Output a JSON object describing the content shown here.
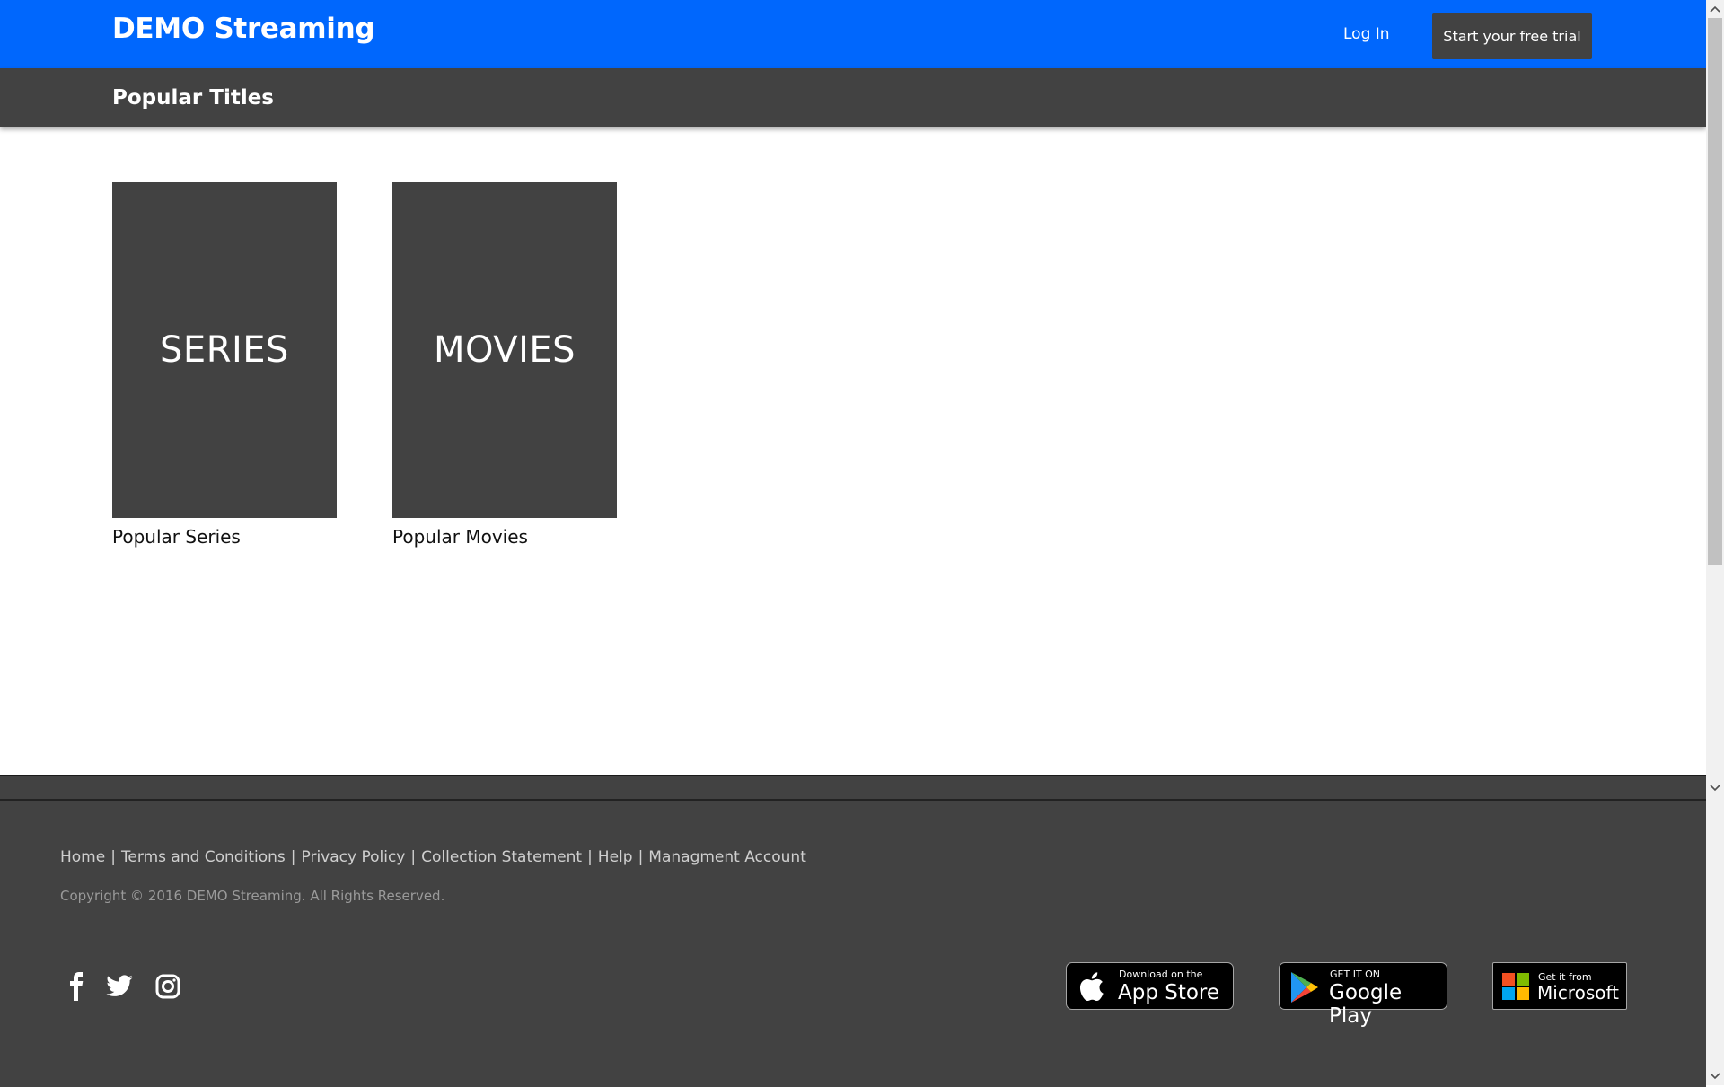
{
  "header": {
    "brand": "DEMO Streaming",
    "login_label": "Log In",
    "trial_label": "Start your free trial"
  },
  "subheader": {
    "title": "Popular Titles"
  },
  "tiles": [
    {
      "poster_text": "SERIES",
      "caption": "Popular Series"
    },
    {
      "poster_text": "MOVIES",
      "caption": "Popular Movies"
    }
  ],
  "footer": {
    "links": [
      "Home",
      "Terms and Conditions",
      "Privacy Policy",
      "Collection Statement",
      "Help",
      "Managment Account"
    ],
    "separator": "|",
    "copyright": "Copyright © 2016 DEMO Streaming. All Rights Reserved.",
    "social": [
      "facebook-icon",
      "twitter-icon",
      "instagram-icon"
    ],
    "badges": {
      "apple": {
        "small": "Download on the",
        "big": "App Store"
      },
      "google": {
        "small": "GET IT ON",
        "big": "Google Play"
      },
      "microsoft": {
        "small": "Get it from",
        "big": "Microsoft"
      }
    }
  },
  "colors": {
    "header_bg": "#0067fd",
    "dark_bg": "#424242"
  }
}
